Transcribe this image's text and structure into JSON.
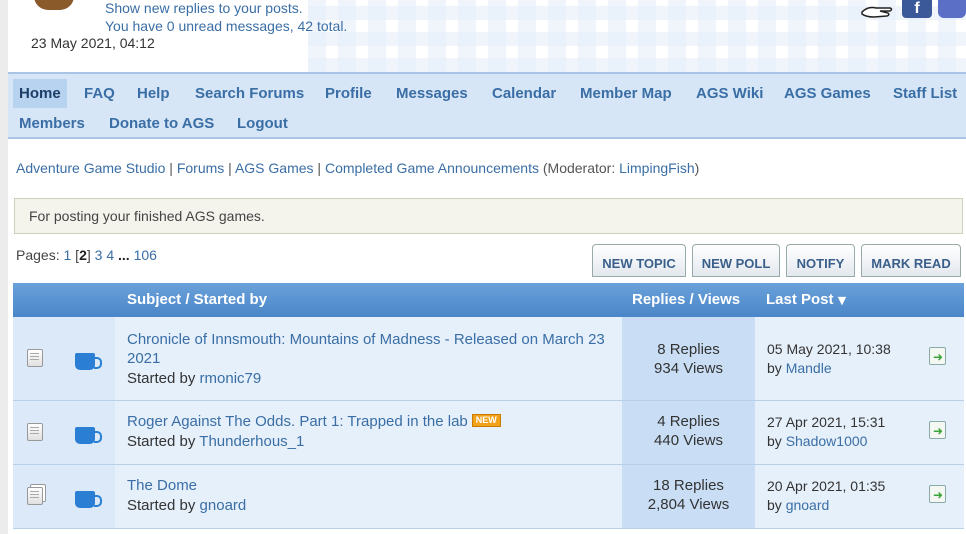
{
  "header": {
    "line1": "Show new replies to your posts.",
    "line2": "You have 0 unread messages, 42 total.",
    "date": "23 May 2021, 04:12",
    "icons": [
      "mascot-icon",
      "hand-icon",
      "facebook-icon",
      "discord-icon"
    ],
    "facebook_glyph": "f"
  },
  "nav": {
    "items": [
      {
        "label": "Home",
        "active": true
      },
      {
        "label": "FAQ"
      },
      {
        "label": "Help"
      },
      {
        "label": "Search Forums"
      },
      {
        "label": "Profile"
      },
      {
        "label": "Messages"
      },
      {
        "label": "Calendar"
      },
      {
        "label": "Member Map"
      },
      {
        "label": "AGS Wiki"
      },
      {
        "label": "AGS Games"
      },
      {
        "label": "Staff List"
      },
      {
        "label": "Members"
      },
      {
        "label": "Donate to AGS"
      },
      {
        "label": "Logout"
      }
    ]
  },
  "breadcrumb": {
    "items": [
      "Adventure Game Studio",
      "Forums",
      "AGS Games",
      "Completed Game Announcements"
    ],
    "separator": " | ",
    "moderator_prefix": "(Moderator: ",
    "moderator": "LimpingFish",
    "moderator_suffix": ")"
  },
  "board_description": "For posting your finished AGS games.",
  "pagination": {
    "label": "Pages:",
    "pages": [
      "1",
      "2",
      "3",
      "4"
    ],
    "current": "2",
    "ellipsis": "...",
    "last": "106"
  },
  "buttons": {
    "new_topic": "NEW TOPIC",
    "new_poll": "NEW POLL",
    "notify": "NOTIFY",
    "mark_read": "MARK READ"
  },
  "table": {
    "headers": {
      "subject": "Subject / Started by",
      "stats": "Replies / Views",
      "last_post": "Last Post",
      "sort_indicator": "▼"
    },
    "started_by_prefix": "Started by",
    "by_prefix": "by",
    "new_badge": "NEW",
    "rows": [
      {
        "title_line1": "Chronicle of Innsmouth: Mountains of Madness - Released on March 23",
        "title_line2": "2021",
        "author": "rmonic79",
        "replies": "8 Replies",
        "views": "934 Views",
        "last_date": "05 May 2021, 10:38",
        "last_by": "Mandle",
        "is_new": false,
        "icon": "document-icon",
        "status_icon": "cup-icon"
      },
      {
        "title_line1": "Roger Against The Odds. Part 1: Trapped in the lab",
        "title_line2": "",
        "author": "Thunderhous_1",
        "replies": "4 Replies",
        "views": "440 Views",
        "last_date": "27 Apr 2021, 15:31",
        "last_by": "Shadow1000",
        "is_new": true,
        "icon": "document-icon",
        "status_icon": "cup-smiley-icon"
      },
      {
        "title_line1": "The Dome",
        "title_line2": "",
        "author": "gnoard",
        "replies": "18 Replies",
        "views": "2,804 Views",
        "last_date": "20 Apr 2021, 01:35",
        "last_by": "gnoard",
        "is_new": false,
        "icon": "multi-document-icon",
        "status_icon": "cup-icon"
      }
    ]
  }
}
